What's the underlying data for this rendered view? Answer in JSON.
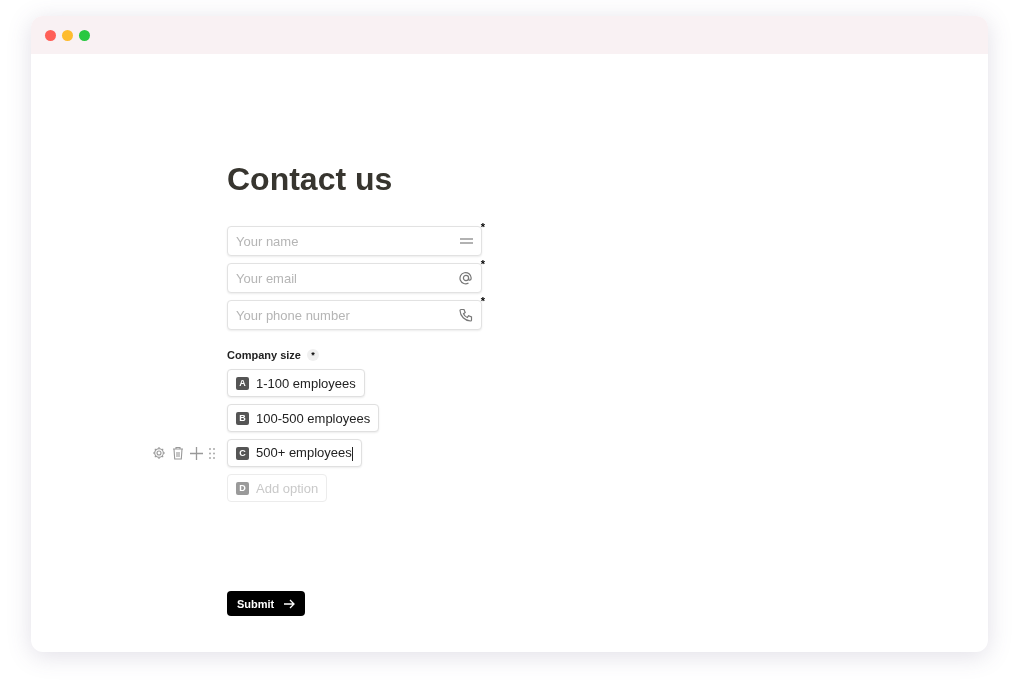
{
  "window": {
    "controls": [
      {
        "color": "#ff5f57"
      },
      {
        "color": "#febc2e"
      },
      {
        "color": "#28c840"
      }
    ]
  },
  "form": {
    "title": "Contact us",
    "fields": [
      {
        "kind": "name",
        "placeholder": "Your name",
        "required_mark": "*"
      },
      {
        "kind": "email",
        "placeholder": "Your email",
        "required_mark": "*"
      },
      {
        "kind": "phone",
        "placeholder": "Your phone number",
        "required_mark": "*"
      }
    ],
    "question": {
      "label": "Company size",
      "required_mark": "*",
      "options": [
        {
          "kind": "option",
          "key": "A",
          "label": "1-100 employees",
          "editing": false
        },
        {
          "kind": "option",
          "key": "B",
          "label": "100-500 employees",
          "editing": false
        },
        {
          "kind": "option",
          "key": "C",
          "label": "500+ employees",
          "editing": true
        },
        {
          "kind": "add",
          "key": "D",
          "label": "Add option",
          "editing": false
        }
      ]
    },
    "submit": {
      "label": "Submit"
    }
  }
}
